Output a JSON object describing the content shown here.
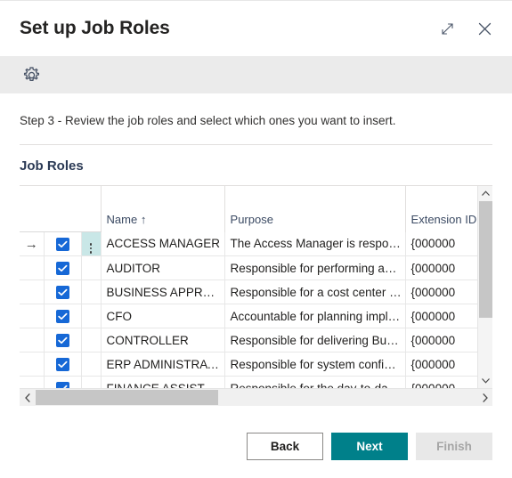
{
  "window": {
    "title": "Set up Job Roles",
    "expand_icon": "expand-diagonal-icon",
    "close_icon": "close-icon",
    "settings_icon": "gear-icon"
  },
  "content": {
    "step_text": "Step 3 - Review the job roles and select which ones you want to insert.",
    "section_title": "Job Roles"
  },
  "grid": {
    "columns": [
      {
        "key": "arrow",
        "label": ""
      },
      {
        "key": "select",
        "label": ""
      },
      {
        "key": "menu",
        "label": ""
      },
      {
        "key": "name",
        "label": "Name ↑"
      },
      {
        "key": "purpose",
        "label": "Purpose"
      },
      {
        "key": "extension_id",
        "label": "Extension ID"
      }
    ],
    "sort_column": "Name",
    "sort_direction": "ascending",
    "rows": [
      {
        "current": true,
        "selected": true,
        "name": "ACCESS MANAGER",
        "purpose": "The Access Manager is responsi...",
        "extension_id": "{000000"
      },
      {
        "current": false,
        "selected": true,
        "name": "AUDITOR",
        "purpose": "Responsible for performing audi...",
        "extension_id": "{000000"
      },
      {
        "current": false,
        "selected": true,
        "name": "BUSINESS APPROV...",
        "purpose": "Responsible for a cost center or...",
        "extension_id": "{000000"
      },
      {
        "current": false,
        "selected": true,
        "name": "CFO",
        "purpose": "Accountable for planning imple...",
        "extension_id": "{000000"
      },
      {
        "current": false,
        "selected": true,
        "name": "CONTROLLER",
        "purpose": "Responsible for delivering Busin...",
        "extension_id": "{000000"
      },
      {
        "current": false,
        "selected": true,
        "name": "ERP ADMINISTRATOR",
        "purpose": "Responsible for system configur...",
        "extension_id": "{000000"
      },
      {
        "current": false,
        "selected": true,
        "name": "FINANCE ASSISTANT",
        "purpose": "Responsible for the day-to-day ...",
        "extension_id": "{000000"
      },
      {
        "current": false,
        "selected": true,
        "name": "",
        "purpose": "",
        "extension_id": ""
      }
    ]
  },
  "scrollbars": {
    "vertical": {
      "up_icon": "chevron-up-icon",
      "down_icon": "chevron-down-icon"
    },
    "horizontal": {
      "left_icon": "chevron-left-icon",
      "right_icon": "chevron-right-icon"
    }
  },
  "footer": {
    "back_label": "Back",
    "next_label": "Next",
    "finish_label": "Finish",
    "finish_disabled": true
  },
  "colors": {
    "accent": "#00808a",
    "checkbox": "#1668d6",
    "current_cell": "#c9e7e7",
    "band": "#ebebeb"
  }
}
